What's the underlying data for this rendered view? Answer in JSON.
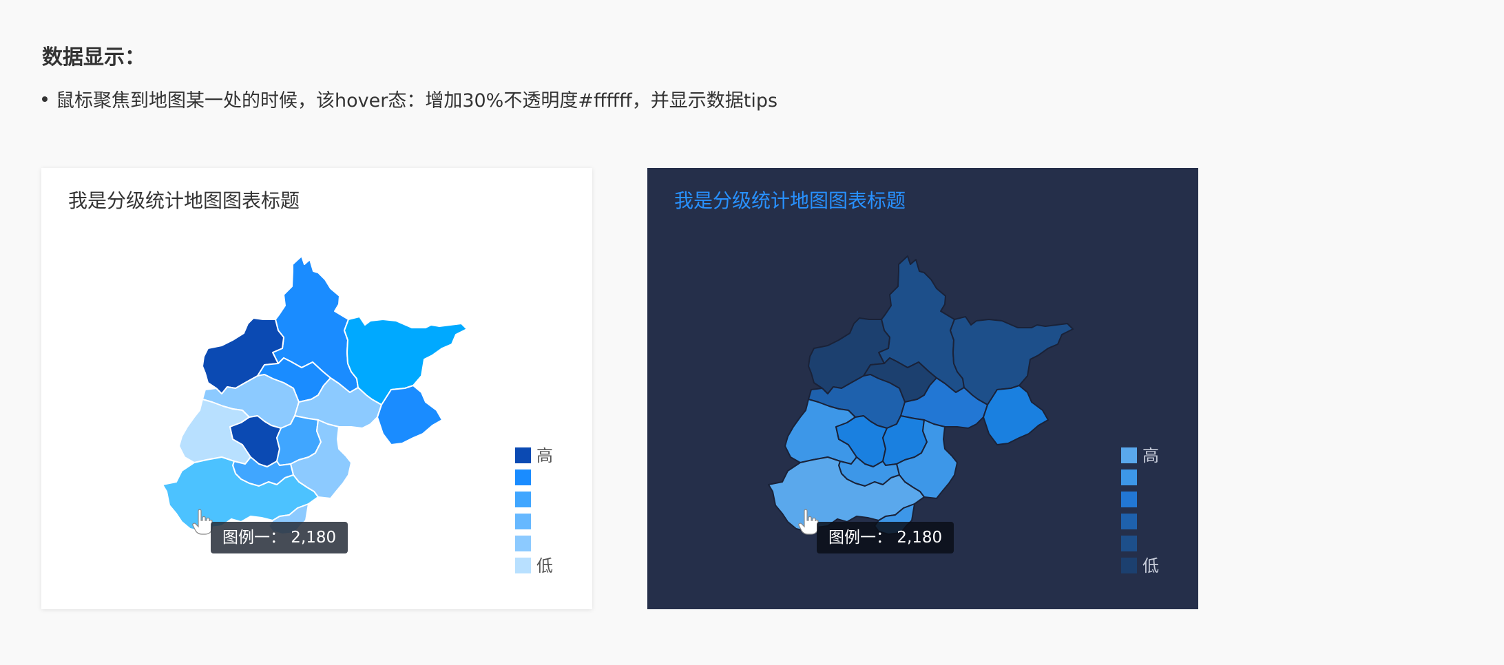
{
  "page": {
    "heading": "数据显示：",
    "bullet": "鼠标聚焦到地图某一处的时候，该hover态：增加30%不透明度#ffffff，并显示数据tips"
  },
  "cards": {
    "light": {
      "title": "我是分级统计地图图表标题",
      "legend": {
        "high": "高",
        "low": "低"
      },
      "tooltip": "图例一：  2,180",
      "colors": {
        "background": "#ffffff",
        "title": "#333333",
        "border": "#ffffff",
        "scale": [
          "#0b4ab3",
          "#1a8cff",
          "#40a6ff",
          "#66b8ff",
          "#8ccaff",
          "#b8e0ff"
        ],
        "accent": "#00a9ff"
      }
    },
    "dark": {
      "title": "我是分级统计地图图表标题",
      "legend": {
        "high": "高",
        "low": "低"
      },
      "tooltip": "图例一：  2,180",
      "colors": {
        "background": "#252f4a",
        "title": "#2891ff",
        "border": "#1a2238",
        "scale": [
          "#5aa8ec",
          "#3d97e8",
          "#2277d4",
          "#1e61ad",
          "#1d4f8a",
          "#1c406f"
        ]
      }
    }
  },
  "icons": {
    "cursor": "hand-pointer-icon"
  }
}
